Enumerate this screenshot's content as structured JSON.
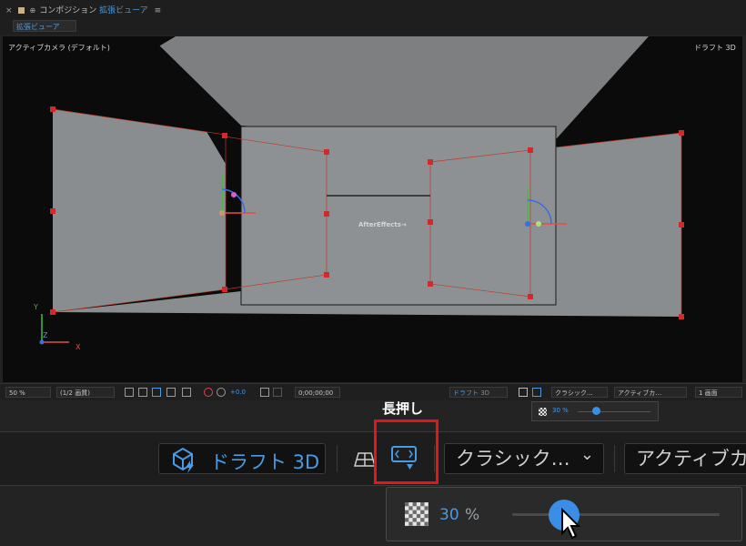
{
  "panel": {
    "close_glyph": "×",
    "title": "コンポジション",
    "title_link": "拡張ビューア",
    "menu_glyph": "≡",
    "subtab": "拡張ビューア"
  },
  "viewer": {
    "camera_label": "アクティブカメラ (デフォルト)",
    "renderer_label": "ドラフト 3D",
    "layer_text": "AfterEffects→",
    "axis_y": "Y",
    "axis_z": "Z",
    "axis_x": "X"
  },
  "small_toolbar": {
    "zoom": "50 %",
    "resolution": "(1/2 画質)",
    "exposure": "+0.0",
    "timecode": "0;00;00;00",
    "draft3d": "ドラフト 3D",
    "renderer": "クラシック…",
    "camera": "アクティブカ…",
    "views": "1 画面"
  },
  "callout": {
    "label": "長押し"
  },
  "small_popup": {
    "zoom_value": "30 %",
    "zoom_fraction": 0.25
  },
  "big_toolbar": {
    "draft3d": "ドラフト 3D",
    "renderer": "クラシック…",
    "renderer_chevron": "⌄",
    "camera": "アクティブカ"
  },
  "big_popup": {
    "zoom_value": "30",
    "zoom_unit": "%",
    "zoom_fraction": 0.25
  },
  "colors": {
    "accent": "#4a9ae4",
    "highlight": "#e8141b",
    "panel": "#1d1d1d"
  },
  "icons": [
    "cube-lightning-icon",
    "mesh-plane-icon",
    "fast-preview-icon",
    "checkerboard-icon",
    "mouse-cursor-icon",
    "camera-snapshot-icon"
  ]
}
